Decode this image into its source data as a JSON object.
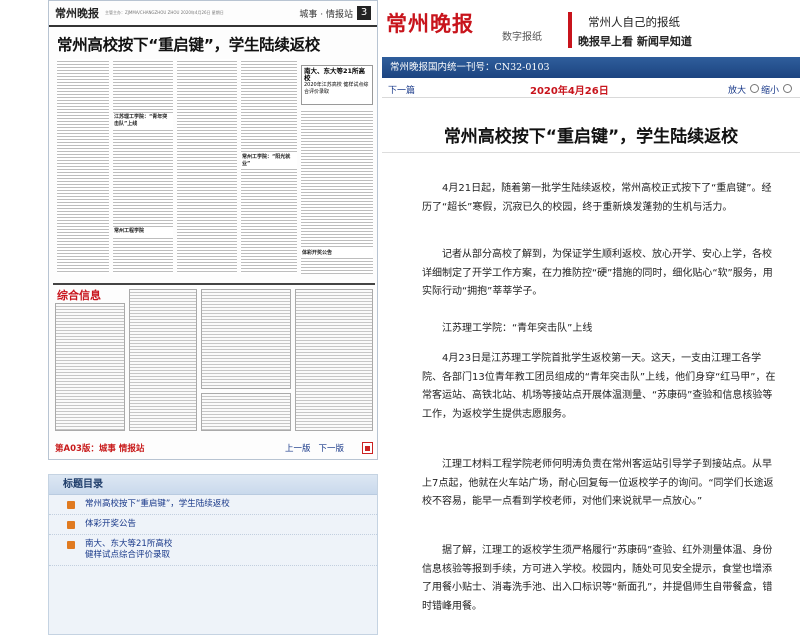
{
  "paper": {
    "logo": "常州晚报",
    "head_info": "主管主办：ZJMMA/CHANGZHOU  ZHOU 2020年4月26日 星期日",
    "section": "城事 · 情报站",
    "page_num": "3",
    "headline": "常州高校按下“重启键”，学生陆续返校",
    "side_box_title": "南大、东大等21所高校",
    "side_box_text": "2020年江苏高校 健样试点综合评价录取",
    "subheads": [
      "江苏理工学院：“青年突击队”上线",
      "常州工学院：“阳光就业”",
      "常州工程学院",
      "体彩开奖公告"
    ],
    "ad_title": "综合信息",
    "page_label": "第A03版：城事 情报站",
    "prev_page": "上一版",
    "next_page": "下一版"
  },
  "toc": {
    "title": "标题目录",
    "items": [
      "常州高校按下“重启键”，学生陆续返校",
      "体彩开奖公告",
      "南大、东大等21所高校\n健样试点综合评价录取"
    ]
  },
  "header": {
    "logo": "常州晚报",
    "logo_sub": "数字报纸",
    "slogan1": "常州人自己的报纸",
    "slogan2": "晚报早上看 新闻早知道",
    "pub": "常州晚报国内统一刊号：CN32-0103"
  },
  "nav": {
    "prev": "下一篇",
    "date": "2020年4月26日",
    "zoom_in": "放大",
    "zoom_out": "缩小"
  },
  "article": {
    "title": "常州高校按下“重启键”，学生陆续返校",
    "paragraphs": [
      "4月21日起，随着第一批学生陆续返校，常州高校正式按下了“重启键”。经历了“超长”寒假，沉寂已久的校园，终于重新焕发蓬勃的生机与活力。",
      "记者从部分高校了解到，为保证学生顺利返校、放心开学、安心上学，各校详细制定了开学工作方案，在力推防控“硬”措施的同时，细化贴心“软”服务，用实际行动“拥抱”莘莘学子。",
      "江苏理工学院：“青年突击队”上线",
      "4月23日是江苏理工学院首批学生返校第一天。这天，一支由江理工各学院、各部门13位青年教工团员组成的“青年突击队”上线，他们身穿“红马甲”，在常客运站、高铁北站、机场等接站点开展体温测量、“苏康码”查验和信息核验等工作，为返校学生提供志愿服务。",
      "江理工材料工程学院老师何明涛负责在常州客运站引导学子到接站点。从早上7点起，他就在火车站广场，耐心回复每一位返校学子的询问。“同学们长途返校不容易，能早一点看到学校老师，对他们来说就早一点放心。”",
      "据了解，江理工的返校学生须严格履行“苏康码”查验、红外测量体温、身份信息核验等报到手续，方可进入学校。校园内，随处可见安全提示，食堂也增添了用餐小贴士、消毒洗手池、出入口标识等“新面孔”，并提倡师生自带餐盒，错时错峰用餐。"
    ]
  }
}
